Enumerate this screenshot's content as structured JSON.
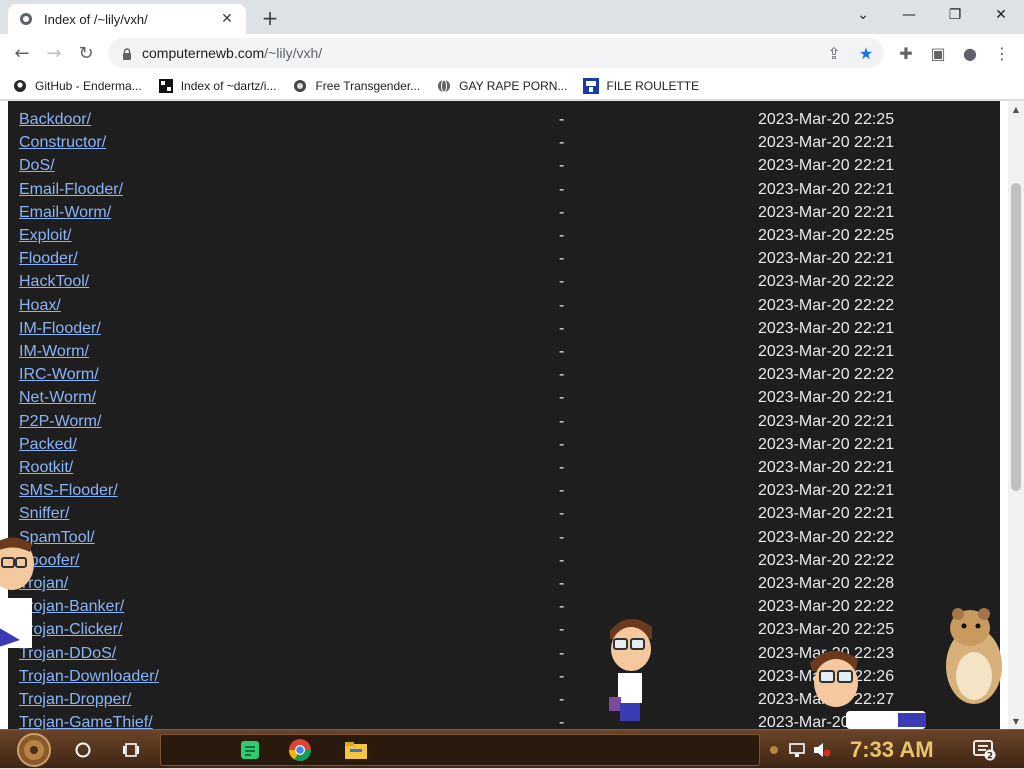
{
  "browser": {
    "tab_title": "Index of /~lily/vxh/",
    "url_host": "computernewb.com",
    "url_path": "/~lily/vxh/"
  },
  "bookmarks": [
    {
      "label": "GitHub - Enderma...",
      "icon": "github-icon"
    },
    {
      "label": "Index of ~dartz/i...",
      "icon": "pixel-icon"
    },
    {
      "label": "Free Transgender...",
      "icon": "bookmark-site-icon"
    },
    {
      "label": "GAY RAPE PORN...",
      "icon": "globe-icon"
    },
    {
      "label": "FILE ROULETTE",
      "icon": "roulette-icon"
    }
  ],
  "listing": {
    "rows": [
      {
        "name": "Backdoor/",
        "size": "-",
        "date": "2023-Mar-20 22:25"
      },
      {
        "name": "Constructor/",
        "size": "-",
        "date": "2023-Mar-20 22:21"
      },
      {
        "name": "DoS/",
        "size": "-",
        "date": "2023-Mar-20 22:21"
      },
      {
        "name": "Email-Flooder/",
        "size": "-",
        "date": "2023-Mar-20 22:21"
      },
      {
        "name": "Email-Worm/",
        "size": "-",
        "date": "2023-Mar-20 22:21"
      },
      {
        "name": "Exploit/",
        "size": "-",
        "date": "2023-Mar-20 22:25"
      },
      {
        "name": "Flooder/",
        "size": "-",
        "date": "2023-Mar-20 22:21"
      },
      {
        "name": "HackTool/",
        "size": "-",
        "date": "2023-Mar-20 22:22"
      },
      {
        "name": "Hoax/",
        "size": "-",
        "date": "2023-Mar-20 22:22"
      },
      {
        "name": "IM-Flooder/",
        "size": "-",
        "date": "2023-Mar-20 22:21"
      },
      {
        "name": "IM-Worm/",
        "size": "-",
        "date": "2023-Mar-20 22:21"
      },
      {
        "name": "IRC-Worm/",
        "size": "-",
        "date": "2023-Mar-20 22:22"
      },
      {
        "name": "Net-Worm/",
        "size": "-",
        "date": "2023-Mar-20 22:21"
      },
      {
        "name": "P2P-Worm/",
        "size": "-",
        "date": "2023-Mar-20 22:21"
      },
      {
        "name": "Packed/",
        "size": "-",
        "date": "2023-Mar-20 22:21"
      },
      {
        "name": "Rootkit/",
        "size": "-",
        "date": "2023-Mar-20 22:21"
      },
      {
        "name": "SMS-Flooder/",
        "size": "-",
        "date": "2023-Mar-20 22:21"
      },
      {
        "name": "Sniffer/",
        "size": "-",
        "date": "2023-Mar-20 22:21"
      },
      {
        "name": "SpamTool/",
        "size": "-",
        "date": "2023-Mar-20 22:22"
      },
      {
        "name": "Spoofer/",
        "size": "-",
        "date": "2023-Mar-20 22:22"
      },
      {
        "name": "Trojan/",
        "size": "-",
        "date": "2023-Mar-20 22:28"
      },
      {
        "name": "Trojan-Banker/",
        "size": "-",
        "date": "2023-Mar-20 22:22"
      },
      {
        "name": "Trojan-Clicker/",
        "size": "-",
        "date": "2023-Mar-20 22:25"
      },
      {
        "name": "Trojan-DDoS/",
        "size": "-",
        "date": "2023-Mar-20 22:23"
      },
      {
        "name": "Trojan-Downloader/",
        "size": "-",
        "date": "2023-Mar-20 22:26"
      },
      {
        "name": "Trojan-Dropper/",
        "size": "-",
        "date": "2023-Mar-20 22:27"
      },
      {
        "name": "Trojan-GameThief/",
        "size": "-",
        "date": "2023-Mar-20 22:2"
      }
    ]
  },
  "taskbar": {
    "clock": "7:33 AM",
    "notification_count": "2"
  },
  "colors": {
    "link": "#8ab4f8",
    "listing_bg": "#1e1e1e",
    "clock": "#e9c46a"
  }
}
